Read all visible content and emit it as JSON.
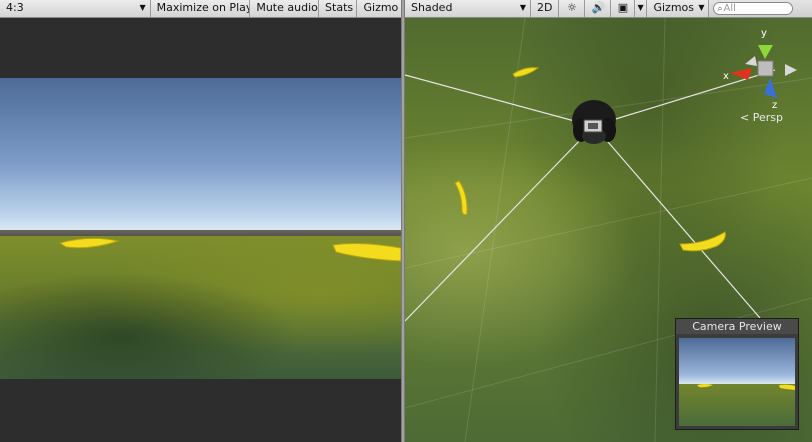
{
  "game_toolbar": {
    "aspect": "4:3",
    "maximize_on_play": "Maximize on Play",
    "mute_audio": "Mute audio",
    "stats": "Stats",
    "gizmos": "Gizmo"
  },
  "scene_toolbar": {
    "shading_mode": "Shaded",
    "mode_2d": "2D",
    "gizmos": "Gizmos",
    "search_placeholder": "All"
  },
  "scene_gizmo": {
    "axis_y": "y",
    "axis_x": "x",
    "axis_z": "z",
    "projection": "Persp"
  },
  "camera_preview": {
    "title": "Camera Preview"
  },
  "colors": {
    "banana": "#f2dc1d",
    "axis_x": "#e0331f",
    "axis_y": "#8fd63c",
    "axis_z": "#3a6fd8"
  }
}
